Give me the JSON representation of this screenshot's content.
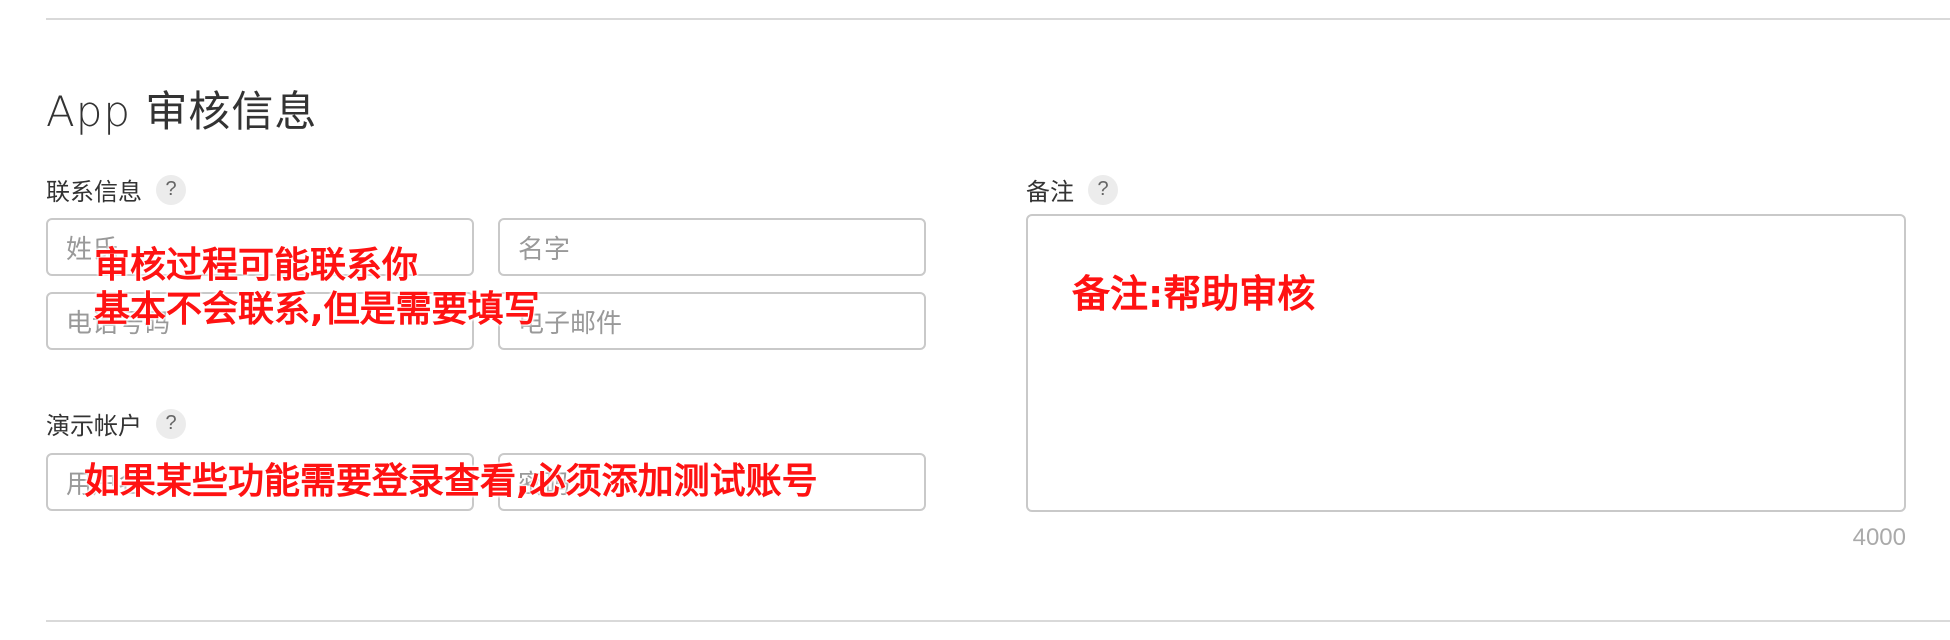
{
  "section": {
    "title": "App 审核信息"
  },
  "contact": {
    "label": "联系信息",
    "help": "?",
    "last_name_placeholder": "姓氏",
    "first_name_placeholder": "名字",
    "phone_placeholder": "电话号码",
    "email_placeholder": "电子邮件"
  },
  "demo": {
    "label": "演示帐户",
    "help": "?",
    "username_placeholder": "用户名",
    "password_placeholder": "密码"
  },
  "notes": {
    "label": "备注",
    "help": "?",
    "char_count": "4000"
  },
  "annotations": {
    "contact_line1": "审核过程可能联系你",
    "contact_line2": "基本不会联系,但是需要填写",
    "demo": "如果某些功能需要登录查看,必须添加测试账号",
    "notes": "备注:帮助审核"
  }
}
